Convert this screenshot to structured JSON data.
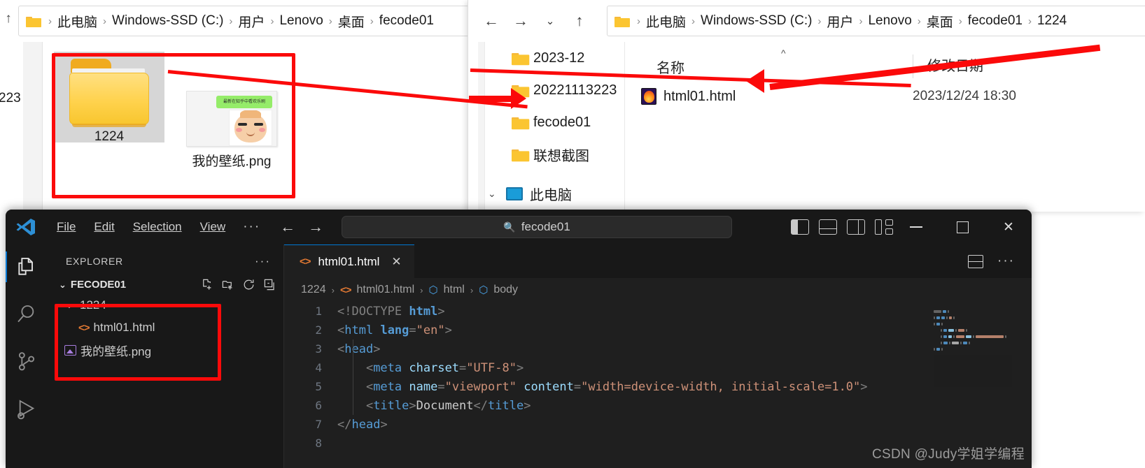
{
  "explorer1": {
    "up_icon": "up-arrow-icon",
    "breadcrumb": [
      "此电脑",
      "Windows-SSD (C:)",
      "用户",
      "Lenovo",
      "桌面",
      "fecode01"
    ],
    "left_label": "223",
    "items": [
      {
        "name": "1224",
        "type": "folder",
        "selected": true
      },
      {
        "name": "我的壁纸.png",
        "type": "image",
        "selected": false
      }
    ],
    "thumb_caption": "最新在知乎中看欢乐刷"
  },
  "explorer2": {
    "nav": {
      "back": "←",
      "forward": "→",
      "recent": "⌄",
      "up": "↑"
    },
    "breadcrumb": [
      "此电脑",
      "Windows-SSD (C:)",
      "用户",
      "Lenovo",
      "桌面",
      "fecode01",
      "1224"
    ],
    "sidebar_items": [
      {
        "label": "2023-12",
        "type": "folder"
      },
      {
        "label": "20221113223",
        "type": "folder"
      },
      {
        "label": "fecode01",
        "type": "folder"
      },
      {
        "label": "联想截图",
        "type": "folder"
      },
      {
        "label": "此电脑",
        "type": "pc",
        "expanded": true
      }
    ],
    "columns": [
      "名称",
      "修改日期"
    ],
    "rows": [
      {
        "name": "html01.html",
        "date": "2023/12/24 18:30",
        "icon": "firefox-html-icon"
      }
    ]
  },
  "vscode": {
    "menu": [
      "File",
      "Edit",
      "Selection",
      "View"
    ],
    "menu_more": "···",
    "search": {
      "value": "fecode01",
      "icon": "search-icon"
    },
    "window_controls": {
      "minimize": "—",
      "maximize": "□",
      "close": "✕"
    },
    "activity_bar": [
      "explorer-icon",
      "search-icon",
      "source-control-icon",
      "run-debug-icon"
    ],
    "sidebar": {
      "title": "EXPLORER",
      "more": "···",
      "root": "FECODE01",
      "root_actions": [
        "new-file-icon",
        "new-folder-icon",
        "refresh-icon",
        "collapse-all-icon"
      ],
      "tree": [
        {
          "label": "1224",
          "type": "folder",
          "depth": 0,
          "expanded": true
        },
        {
          "label": "html01.html",
          "type": "html",
          "depth": 1
        },
        {
          "label": "我的壁纸.png",
          "type": "image",
          "depth": 0
        }
      ]
    },
    "tab": {
      "label": "html01.html",
      "icon": "html-icon",
      "close": "✕"
    },
    "tab_actions": [
      "split-editor-icon",
      "more-actions-icon"
    ],
    "breadcrumbs": [
      "1224",
      "html01.html",
      "html",
      "body"
    ],
    "code_lines": [
      {
        "n": "1",
        "tokens": [
          {
            "t": "<!DOCTYPE ",
            "c": "tk-punct"
          },
          {
            "t": "html",
            "c": "tk-kw"
          },
          {
            "t": ">",
            "c": "tk-punct"
          }
        ]
      },
      {
        "n": "2",
        "tokens": [
          {
            "t": "<",
            "c": "tk-punct"
          },
          {
            "t": "html",
            "c": "tk-tag"
          },
          {
            "t": " ",
            "c": "tk-txt"
          },
          {
            "t": "lang",
            "c": "tk-kw"
          },
          {
            "t": "=",
            "c": "tk-punct"
          },
          {
            "t": "\"en\"",
            "c": "tk-str"
          },
          {
            "t": ">",
            "c": "tk-punct"
          }
        ]
      },
      {
        "n": "3",
        "tokens": [
          {
            "t": "<",
            "c": "tk-punct"
          },
          {
            "t": "head",
            "c": "tk-tag"
          },
          {
            "t": ">",
            "c": "tk-punct"
          }
        ]
      },
      {
        "n": "4",
        "tokens": [
          {
            "t": "    <",
            "c": "tk-punct"
          },
          {
            "t": "meta",
            "c": "tk-tag"
          },
          {
            "t": " ",
            "c": "tk-txt"
          },
          {
            "t": "charset",
            "c": "tk-attr"
          },
          {
            "t": "=",
            "c": "tk-punct"
          },
          {
            "t": "\"UTF-8\"",
            "c": "tk-str"
          },
          {
            "t": ">",
            "c": "tk-punct"
          }
        ]
      },
      {
        "n": "5",
        "tokens": [
          {
            "t": "    <",
            "c": "tk-punct"
          },
          {
            "t": "meta",
            "c": "tk-tag"
          },
          {
            "t": " ",
            "c": "tk-txt"
          },
          {
            "t": "name",
            "c": "tk-attr"
          },
          {
            "t": "=",
            "c": "tk-punct"
          },
          {
            "t": "\"viewport\"",
            "c": "tk-str"
          },
          {
            "t": " ",
            "c": "tk-txt"
          },
          {
            "t": "content",
            "c": "tk-attr"
          },
          {
            "t": "=",
            "c": "tk-punct"
          },
          {
            "t": "\"width=device-width, initial-scale=1.0\"",
            "c": "tk-str"
          },
          {
            "t": ">",
            "c": "tk-punct"
          }
        ]
      },
      {
        "n": "6",
        "tokens": [
          {
            "t": "    <",
            "c": "tk-punct"
          },
          {
            "t": "title",
            "c": "tk-tag"
          },
          {
            "t": ">",
            "c": "tk-punct"
          },
          {
            "t": "Document",
            "c": "tk-txt"
          },
          {
            "t": "</",
            "c": "tk-punct"
          },
          {
            "t": "title",
            "c": "tk-tag"
          },
          {
            "t": ">",
            "c": "tk-punct"
          }
        ]
      },
      {
        "n": "7",
        "tokens": [
          {
            "t": "</",
            "c": "tk-punct"
          },
          {
            "t": "head",
            "c": "tk-tag"
          },
          {
            "t": ">",
            "c": "tk-punct"
          }
        ]
      },
      {
        "n": "8",
        "tokens": []
      }
    ]
  },
  "watermark": "CSDN @Judy学姐学编程",
  "colors": {
    "annotation_red": "#fb0a0a",
    "vscode_bg": "#1f1f1f",
    "vscode_chrome": "#181818",
    "accent_blue": "#0078d4",
    "folder_yellow": "#fbc531"
  }
}
